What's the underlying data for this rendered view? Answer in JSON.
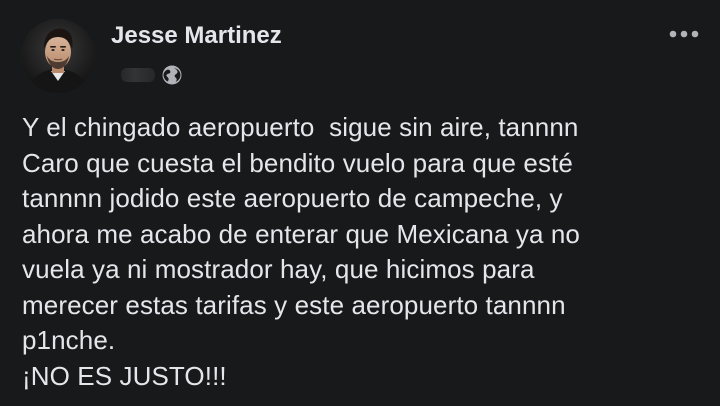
{
  "author": {
    "name": "Jesse Martinez"
  },
  "meta": {
    "privacy_icon": "globe-icon"
  },
  "menu": {
    "icon": "more-horizontal-icon"
  },
  "post": {
    "lines": [
      "Y el chingado aeropuerto  sigue sin aire, tannnn",
      "Caro que cuesta el bendito vuelo para que esté",
      "tannnn jodido este aeropuerto de campeche, y",
      "ahora me acabo de enterar que Mexicana ya no",
      "vuela ya ni mostrador hay, que hicimos para",
      "merecer estas tarifas y este aeropuerto tannnn",
      "p1nche.",
      "¡NO ES JUSTO!!!"
    ]
  },
  "colors": {
    "background": "#18191a",
    "text": "#e4e6eb",
    "secondary": "#b0b3b8"
  }
}
